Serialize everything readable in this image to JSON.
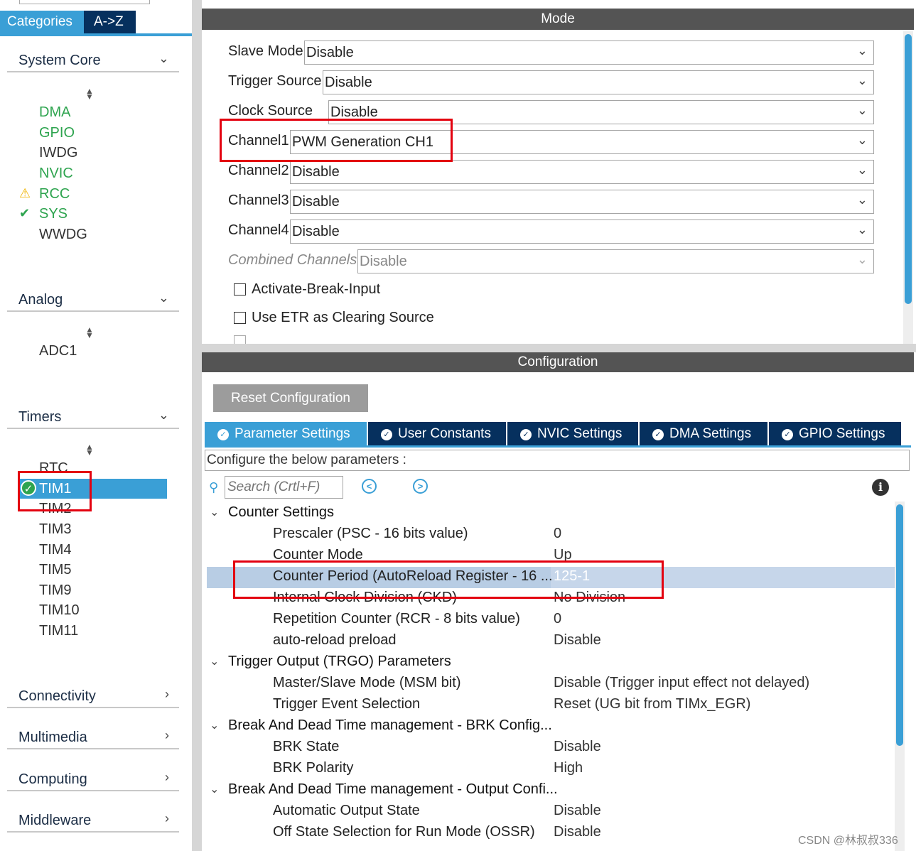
{
  "left_panel": {
    "tabs": [
      "Categories",
      "A->Z"
    ],
    "sections": [
      {
        "label": "System Core",
        "items": [
          "DMA",
          "GPIO",
          "IWDG",
          "NVIC",
          "RCC",
          "SYS",
          "WWDG"
        ]
      },
      {
        "label": "Analog",
        "items": [
          "ADC1"
        ]
      },
      {
        "label": "Timers",
        "items": [
          "RTC",
          "TIM1",
          "TIM2",
          "TIM3",
          "TIM4",
          "TIM5",
          "TIM9",
          "TIM10",
          "TIM11"
        ]
      },
      {
        "label": "Connectivity"
      },
      {
        "label": "Multimedia"
      },
      {
        "label": "Computing"
      },
      {
        "label": "Middleware"
      }
    ]
  },
  "mode": {
    "title": "Mode",
    "rows": [
      {
        "label": "Slave Mode",
        "value": "Disable"
      },
      {
        "label": "Trigger Source",
        "value": "Disable"
      },
      {
        "label": "Clock Source",
        "value": "Disable"
      },
      {
        "label": "Channel1",
        "value": "PWM Generation CH1"
      },
      {
        "label": "Channel2",
        "value": "Disable"
      },
      {
        "label": "Channel3",
        "value": "Disable"
      },
      {
        "label": "Channel4",
        "value": "Disable"
      },
      {
        "label": "Combined Channels",
        "value": "Disable"
      }
    ],
    "checkboxes": [
      "Activate-Break-Input",
      "Use ETR as Clearing Source"
    ]
  },
  "config": {
    "title": "Configuration",
    "reset_label": "Reset Configuration",
    "tabs": [
      "Parameter Settings",
      "User Constants",
      "NVIC Settings",
      "DMA Settings",
      "GPIO Settings"
    ],
    "hint": "Configure the below parameters :",
    "search_placeholder": "Search (Crtl+F)",
    "groups": [
      {
        "label": "Counter Settings",
        "params": [
          {
            "name": "Prescaler (PSC - 16 bits value)",
            "value": "0"
          },
          {
            "name": "Counter Mode",
            "value": "Up"
          },
          {
            "name": "Counter Period (AutoReload Register - 16 ...",
            "value": "125-1"
          },
          {
            "name": "Internal Clock Division (CKD)",
            "value": "No Division"
          },
          {
            "name": "Repetition Counter (RCR - 8 bits value)",
            "value": "0"
          },
          {
            "name": "auto-reload preload",
            "value": "Disable"
          }
        ]
      },
      {
        "label": "Trigger Output (TRGO) Parameters",
        "params": [
          {
            "name": "Master/Slave Mode (MSM bit)",
            "value": "Disable (Trigger input effect not delayed)"
          },
          {
            "name": "Trigger Event Selection",
            "value": "Reset (UG bit from TIMx_EGR)"
          }
        ]
      },
      {
        "label": "Break And Dead Time management - BRK Config...",
        "params": [
          {
            "name": "BRK State",
            "value": "Disable"
          },
          {
            "name": "BRK Polarity",
            "value": "High"
          }
        ]
      },
      {
        "label": "Break And Dead Time management - Output Confi...",
        "params": [
          {
            "name": "Automatic Output State",
            "value": "Disable"
          },
          {
            "name": "Off State Selection for Run Mode (OSSR)",
            "value": "Disable"
          }
        ]
      }
    ]
  },
  "watermark": "CSDN @林叔叔336",
  "colors": {
    "accent": "#3a9fd6",
    "dark_tab": "#06305e",
    "highlight": "#e3000f",
    "ok": "#2ea44f",
    "warn": "#f0b400"
  }
}
